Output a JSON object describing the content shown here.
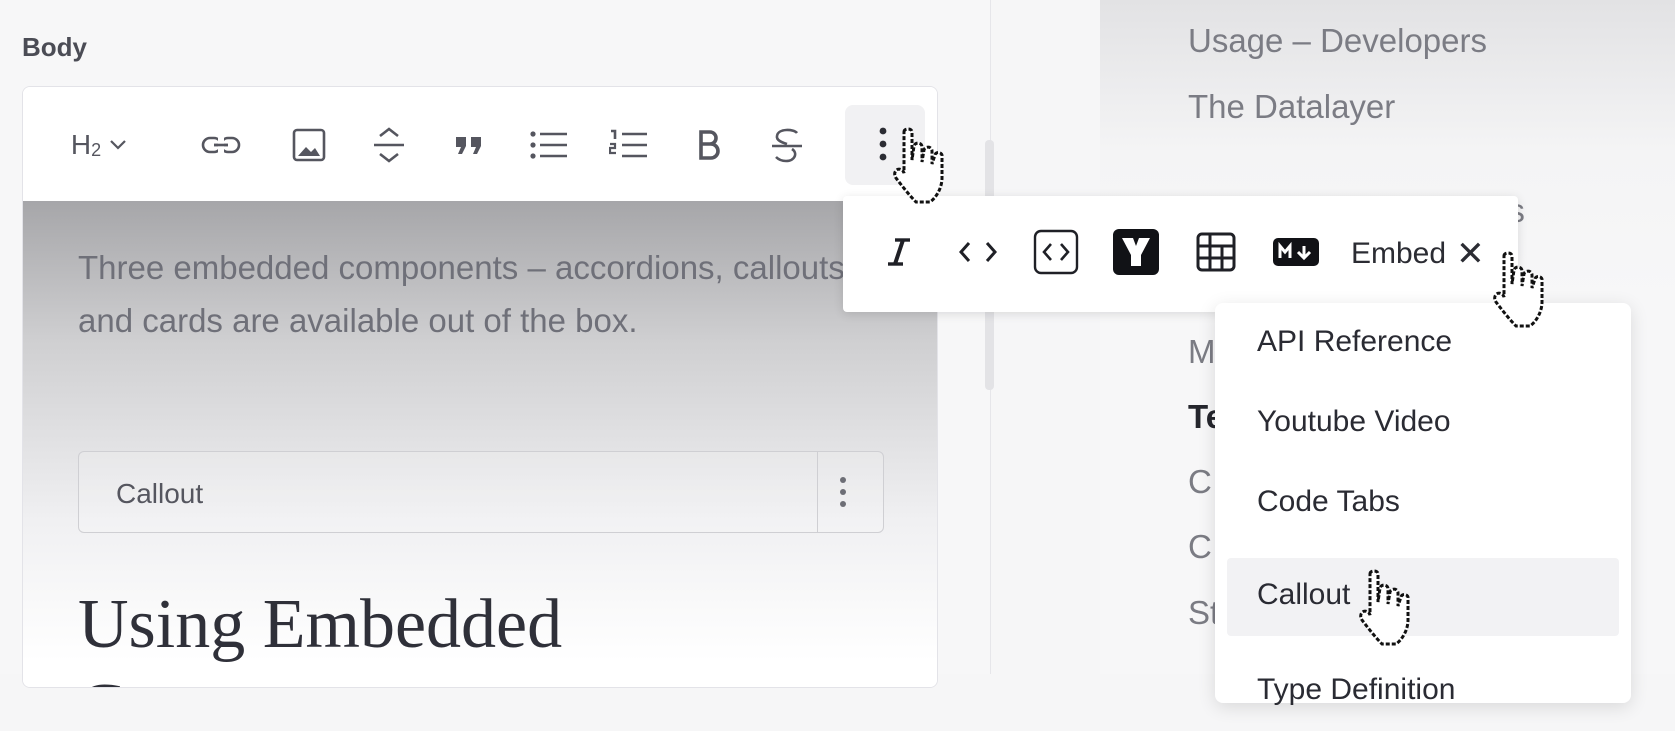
{
  "editor": {
    "body_label": "Body",
    "toolbar": {
      "heading_label": "H2",
      "heading_base": "H",
      "heading_sub": "2"
    },
    "paragraph": "Three embedded components – accordions, callouts and cards are available out of the box.",
    "callout_label": "Callout",
    "heading": "Using Embedded Components"
  },
  "overflow_toolbar": {
    "embed_label": "Embed",
    "close_glyph": "✕"
  },
  "embed_menu": {
    "items": [
      {
        "label": "API Reference"
      },
      {
        "label": "Youtube Video"
      },
      {
        "label": "Code Tabs"
      },
      {
        "label": "Callout"
      },
      {
        "label": "Type Definition"
      }
    ],
    "active_item": "Callout"
  },
  "sidebar": {
    "items": [
      {
        "label": "Usage – Developers"
      },
      {
        "label": "The Datalayer"
      },
      {
        "label": "es"
      },
      {
        "label": "M"
      },
      {
        "label": "Te"
      },
      {
        "label": "C"
      },
      {
        "label": "C"
      },
      {
        "label": "St"
      }
    ]
  },
  "icons": [
    "chevron-down-icon",
    "link-icon",
    "image-icon",
    "divider-icon",
    "quote-icon",
    "bullet-list-icon",
    "numbered-list-icon",
    "bold-icon",
    "strikethrough-icon",
    "more-vertical-icon",
    "italic-icon",
    "inline-code-icon",
    "code-block-icon",
    "y-logo-icon",
    "table-icon",
    "markdown-icon",
    "close-icon",
    "pointer-hand-icon"
  ]
}
